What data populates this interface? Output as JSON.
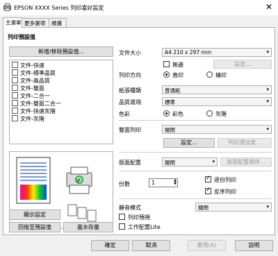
{
  "title": "EPSON  XXXX Series  列印喜好設定",
  "tabs": [
    "主選單",
    "更多選項",
    "維護"
  ],
  "preset": {
    "header": "列印預設值",
    "add_remove_button": "新增/移除預設值...",
    "items": [
      "文件-快速",
      "文件-標準品質",
      "文件-高品質",
      "文件-雙面",
      "文件-二合一",
      "文件-雙面二合一",
      "文件-快速灰階",
      "文件-灰階"
    ]
  },
  "left_buttons": {
    "show_settings": "顯示設定",
    "restore_defaults": "回復至預設值",
    "ink_levels": "墨水存量"
  },
  "paper_size": {
    "label": "文件大小",
    "value": "A4 210 x 297 mm"
  },
  "borderless": {
    "label": "無邊",
    "checked": false,
    "settings_button": "設定..."
  },
  "orientation": {
    "label": "列印方向",
    "portrait": "直印",
    "landscape": "橫印",
    "selected": "portrait"
  },
  "paper_type": {
    "label": "紙張種類",
    "value": "普通紙"
  },
  "quality": {
    "label": "品質選項",
    "value": "標準"
  },
  "color": {
    "label": "色彩",
    "color_option": "彩色",
    "grayscale_option": "灰階",
    "selected": "color"
  },
  "duplex": {
    "label": "雙面列印",
    "value": "關閉",
    "settings_button": "設定...",
    "density_button": "列印濃淡度..."
  },
  "layout": {
    "label": "版面配置",
    "value": "關閉",
    "order_button": "版面配置順序..."
  },
  "copies": {
    "label": "份數",
    "value": "1",
    "collate": "逐份列印",
    "collate_checked": true,
    "reverse": "反序列印",
    "reverse_checked": true
  },
  "quiet_mode": {
    "label": "靜音模式",
    "value": "關閉"
  },
  "print_preview": {
    "label": "列印預視",
    "checked": false
  },
  "job_arranger": {
    "label": "工作配置Lite",
    "checked": false
  },
  "bottom_buttons": {
    "ok": "確定",
    "cancel": "取消",
    "apply": "套用(A)",
    "help": "說明"
  }
}
